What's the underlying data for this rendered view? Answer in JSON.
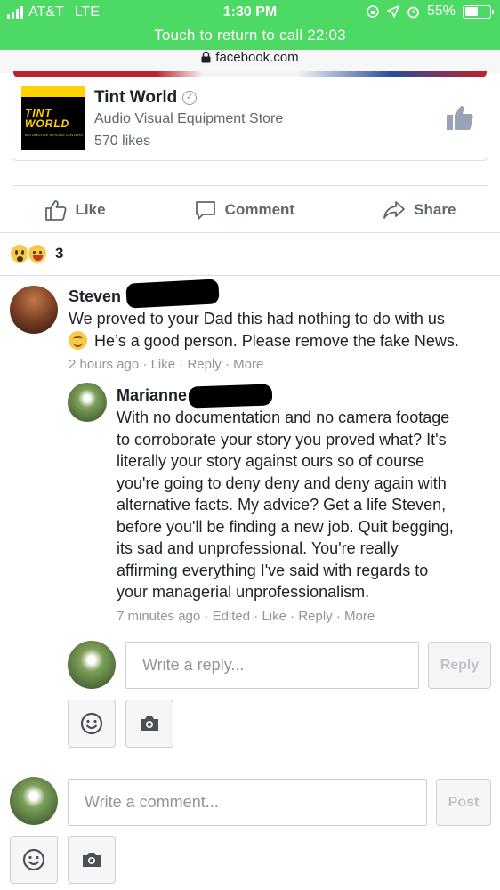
{
  "status_bar": {
    "carrier": "AT&T",
    "network": "LTE",
    "time": "1:30 PM",
    "battery": "55%",
    "battery_level": 0.55,
    "return_call": "Touch to return to call 22:03"
  },
  "browser": {
    "url": "facebook.com"
  },
  "page_card": {
    "name": "Tint World",
    "category": "Audio Visual Equipment Store",
    "likes": "570 likes",
    "logo_text_1": "TINT",
    "logo_text_2": "WORLD",
    "logo_subtext": "AUTOMOTIVE STYLING CENTERS"
  },
  "actions": {
    "like": "Like",
    "comment": "Comment",
    "share": "Share"
  },
  "reactions": {
    "count": "3"
  },
  "comments": [
    {
      "author": "Steven",
      "text_1": "We proved to your Dad this had nothing to do with us",
      "text_2": "He’s a good person. Please remove the fake News.",
      "time": "2 hours ago",
      "like": "Like",
      "reply": "Reply",
      "more": "More",
      "replies": [
        {
          "author": "Marianne",
          "lines": [
            "With no documentation and no camera footage",
            "to corroborate your story you proved what? It's",
            "literally your story against ours so of course",
            "you're going to deny deny and deny again with",
            "alternative facts. My advice? Get a life Steven,",
            "before you'll be finding a new job. Quit begging,",
            "its sad and unprofessional. You're really",
            "affirming everything I've said with regards to",
            "your managerial unprofessionalism."
          ],
          "time": "7 minutes ago",
          "edited": "Edited",
          "like": "Like",
          "reply": "Reply",
          "more": "More"
        }
      ]
    }
  ],
  "reply_composer": {
    "placeholder": "Write a reply...",
    "button": "Reply"
  },
  "comment_composer": {
    "placeholder": "Write a comment...",
    "button": "Post"
  },
  "colors": {
    "callbar": "#4cd964",
    "fb_blue": "#4267b2",
    "meta_gray": "#90949c"
  }
}
